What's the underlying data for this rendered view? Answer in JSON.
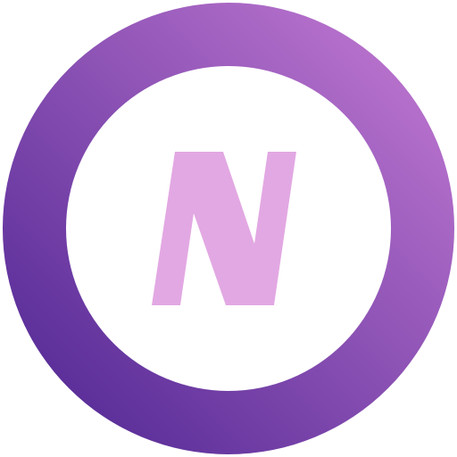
{
  "logo": {
    "letter": "N",
    "colors": {
      "ring_gradient_start": "#c77dd5",
      "ring_gradient_end": "#4a2290",
      "inner_fill": "#ffffff",
      "letter_fill": "#e2a8e3",
      "background": "#ffffff"
    }
  }
}
